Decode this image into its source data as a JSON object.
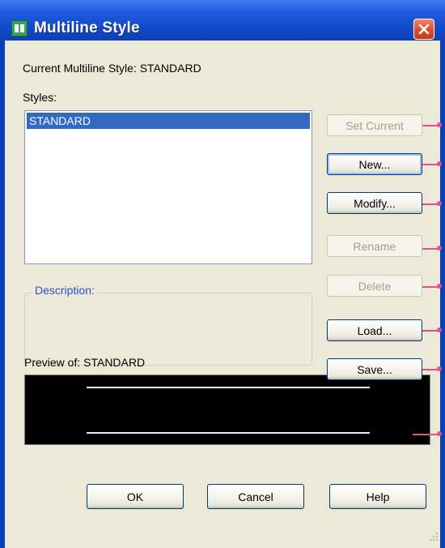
{
  "window": {
    "title": "Multiline Style"
  },
  "current_style": {
    "label": "Current Multiline Style: STANDARD"
  },
  "styles": {
    "label": "Styles:",
    "items": [
      "STANDARD"
    ],
    "selected": "STANDARD"
  },
  "description": {
    "label": "Description:"
  },
  "preview": {
    "label": "Preview of: STANDARD"
  },
  "buttons": {
    "set_current": "Set Current",
    "new": "New...",
    "modify": "Modify...",
    "rename": "Rename",
    "delete": "Delete",
    "load": "Load...",
    "save": "Save...",
    "ok": "OK",
    "cancel": "Cancel",
    "help": "Help"
  },
  "icons": {
    "app": "multiline-style-icon",
    "close": "close-icon"
  },
  "colors": {
    "title_bar": "#1f5de0",
    "selection": "#316ac5",
    "callout": "#e0508a",
    "dialog_bg": "#ece9d8"
  }
}
